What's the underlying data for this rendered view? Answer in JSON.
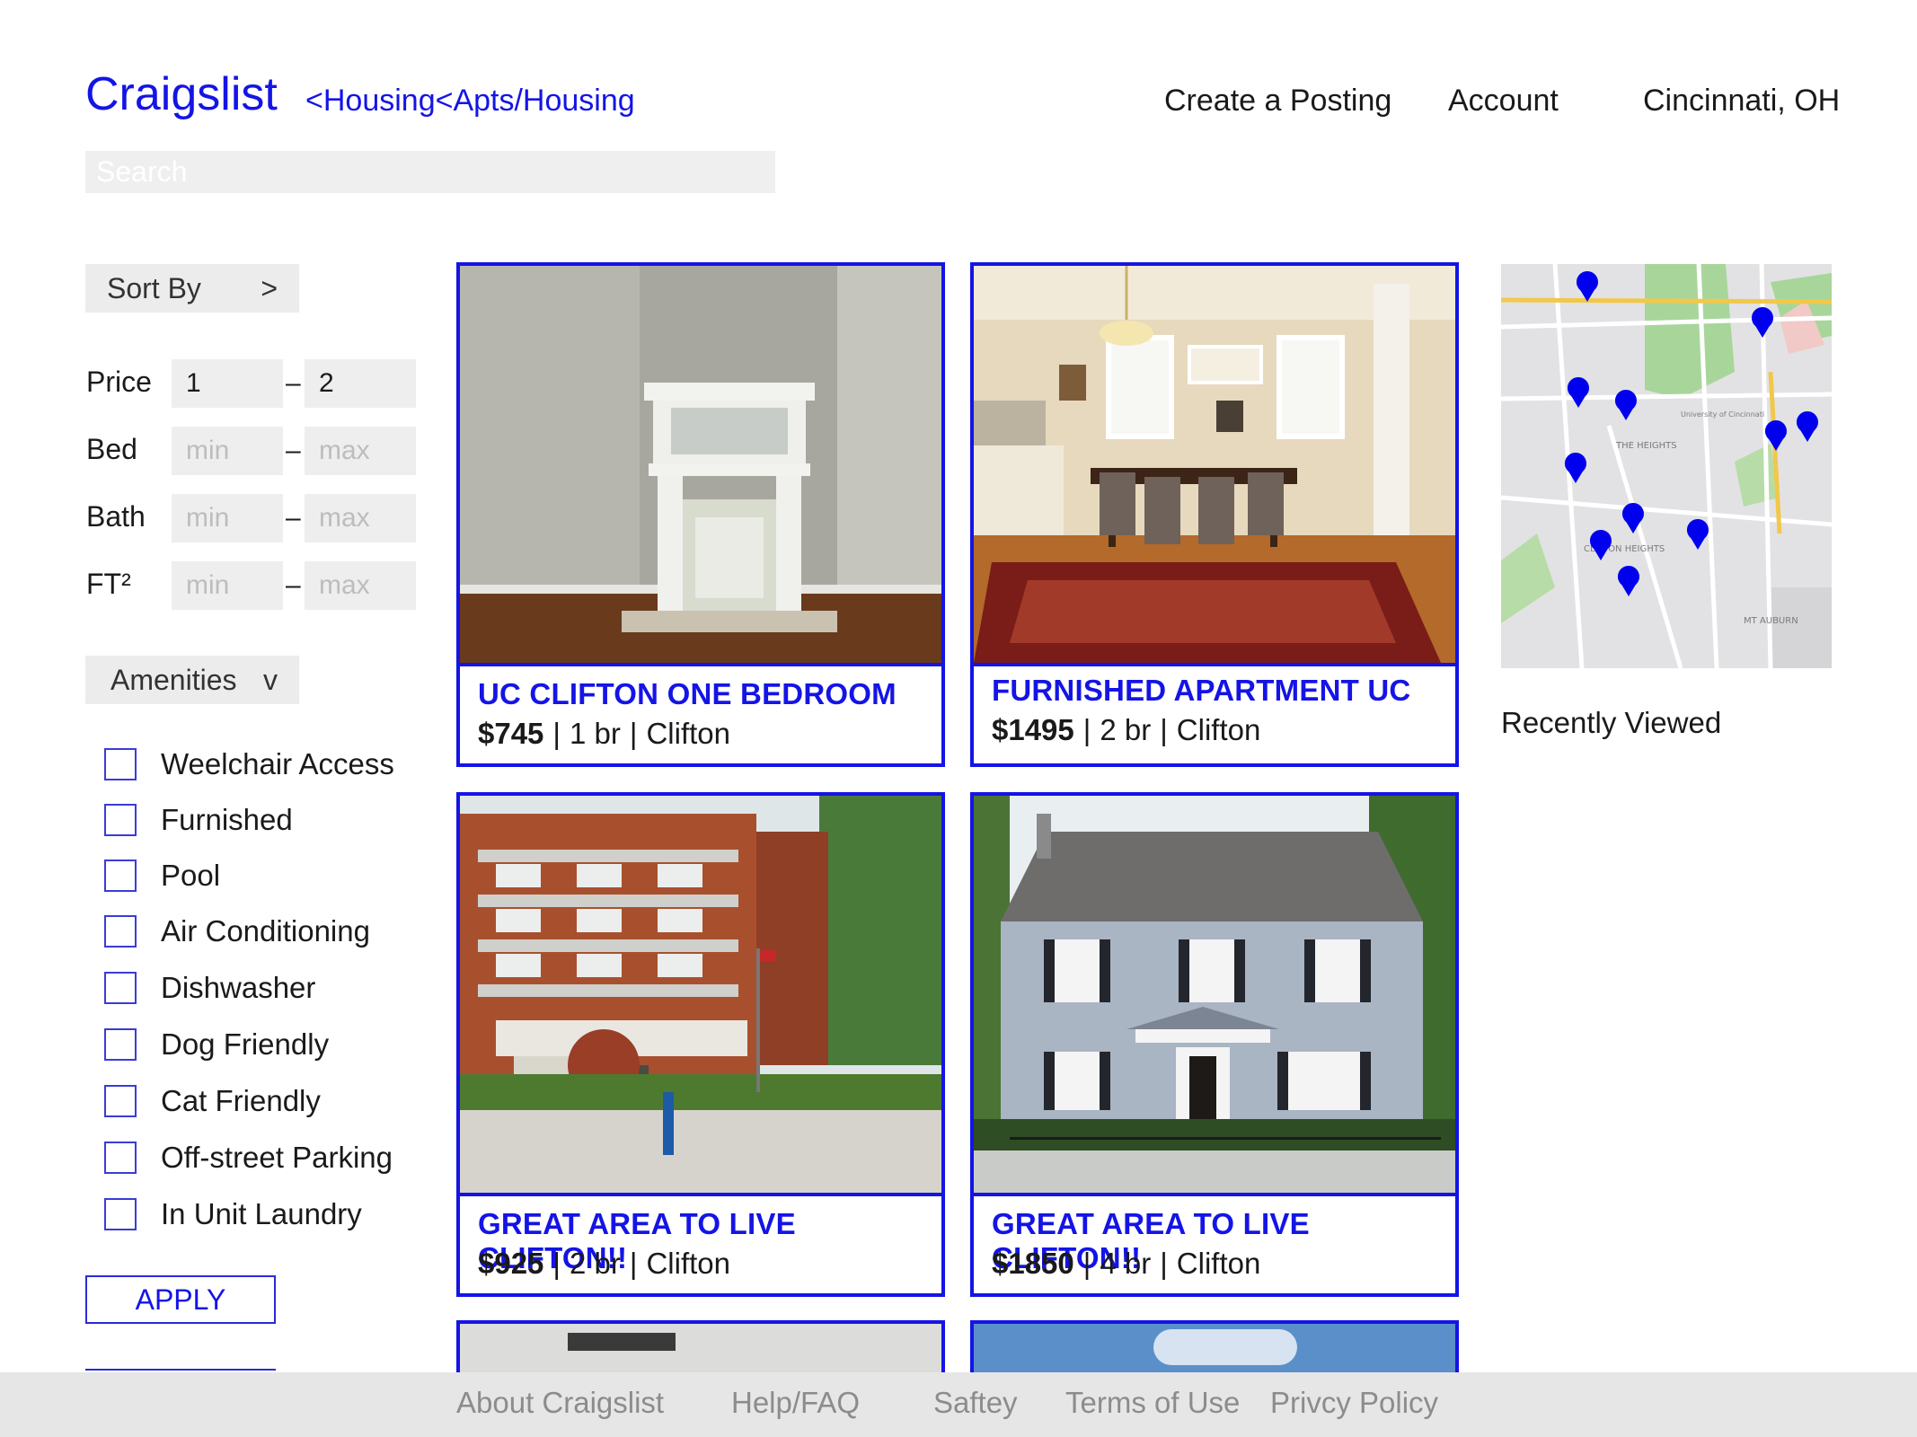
{
  "header": {
    "logo": "Craigslist",
    "breadcrumb": "<Housing<Apts/Housing",
    "nav": [
      "Create a Posting",
      "Account",
      "Cincinnati, OH"
    ],
    "search_placeholder": "Search"
  },
  "filters": {
    "sort_label": "Sort By",
    "sort_chevron": ">",
    "ranges": [
      {
        "label": "Price",
        "min": "1",
        "max": "2",
        "min_placeholder": "",
        "max_placeholder": ""
      },
      {
        "label": "Bed",
        "min": "",
        "max": "",
        "min_placeholder": "min",
        "max_placeholder": "max"
      },
      {
        "label": "Bath",
        "min": "",
        "max": "",
        "min_placeholder": "min",
        "max_placeholder": "max"
      },
      {
        "label": "FT²",
        "min": "",
        "max": "",
        "min_placeholder": "min",
        "max_placeholder": "max"
      }
    ],
    "range_separator": "–",
    "amenities_label": "Amenities",
    "amenities_chevron": "v",
    "amenities": [
      "Weelchair Access",
      "Furnished",
      "Pool",
      "Air Conditioning",
      "Dishwasher",
      "Dog Friendly",
      "Cat Friendly",
      "Off-street Parking",
      "In Unit Laundry"
    ],
    "apply_label": "APPLY"
  },
  "listings": [
    {
      "title": "UC CLIFTON ONE BEDROOM",
      "price": "$745",
      "beds": "1 br",
      "area": "Clifton",
      "photo": "fireplace-room"
    },
    {
      "title": "FURNISHED APARTMENT UC",
      "price": "$1495",
      "beds": "2 br",
      "area": "Clifton",
      "photo": "dining-room"
    },
    {
      "title": "GREAT AREA TO LIVE CLIFTON!!",
      "price": "$925",
      "beds": "2 br",
      "area": "Clifton",
      "photo": "brick-apartment"
    },
    {
      "title": "GREAT AREA TO LIVE CLIFTON!!",
      "price": "$1850",
      "beds": "4 br",
      "area": "Clifton",
      "photo": "blue-house"
    }
  ],
  "map": {
    "labels": [
      "THE HEIGHTS",
      "CLIFTON HEIGHTS",
      "MT AUBURN",
      "University of Cincinnati"
    ],
    "pin_color": "#0000ee"
  },
  "recently_viewed": "Recently Viewed",
  "footer": [
    "About Craigslist",
    "Help/FAQ",
    "Saftey",
    "Terms of Use",
    "Privcy Policy"
  ],
  "colors": {
    "accent": "#1414e6",
    "footer_bg": "#e6e6e6",
    "field_bg": "#eeeeee"
  }
}
